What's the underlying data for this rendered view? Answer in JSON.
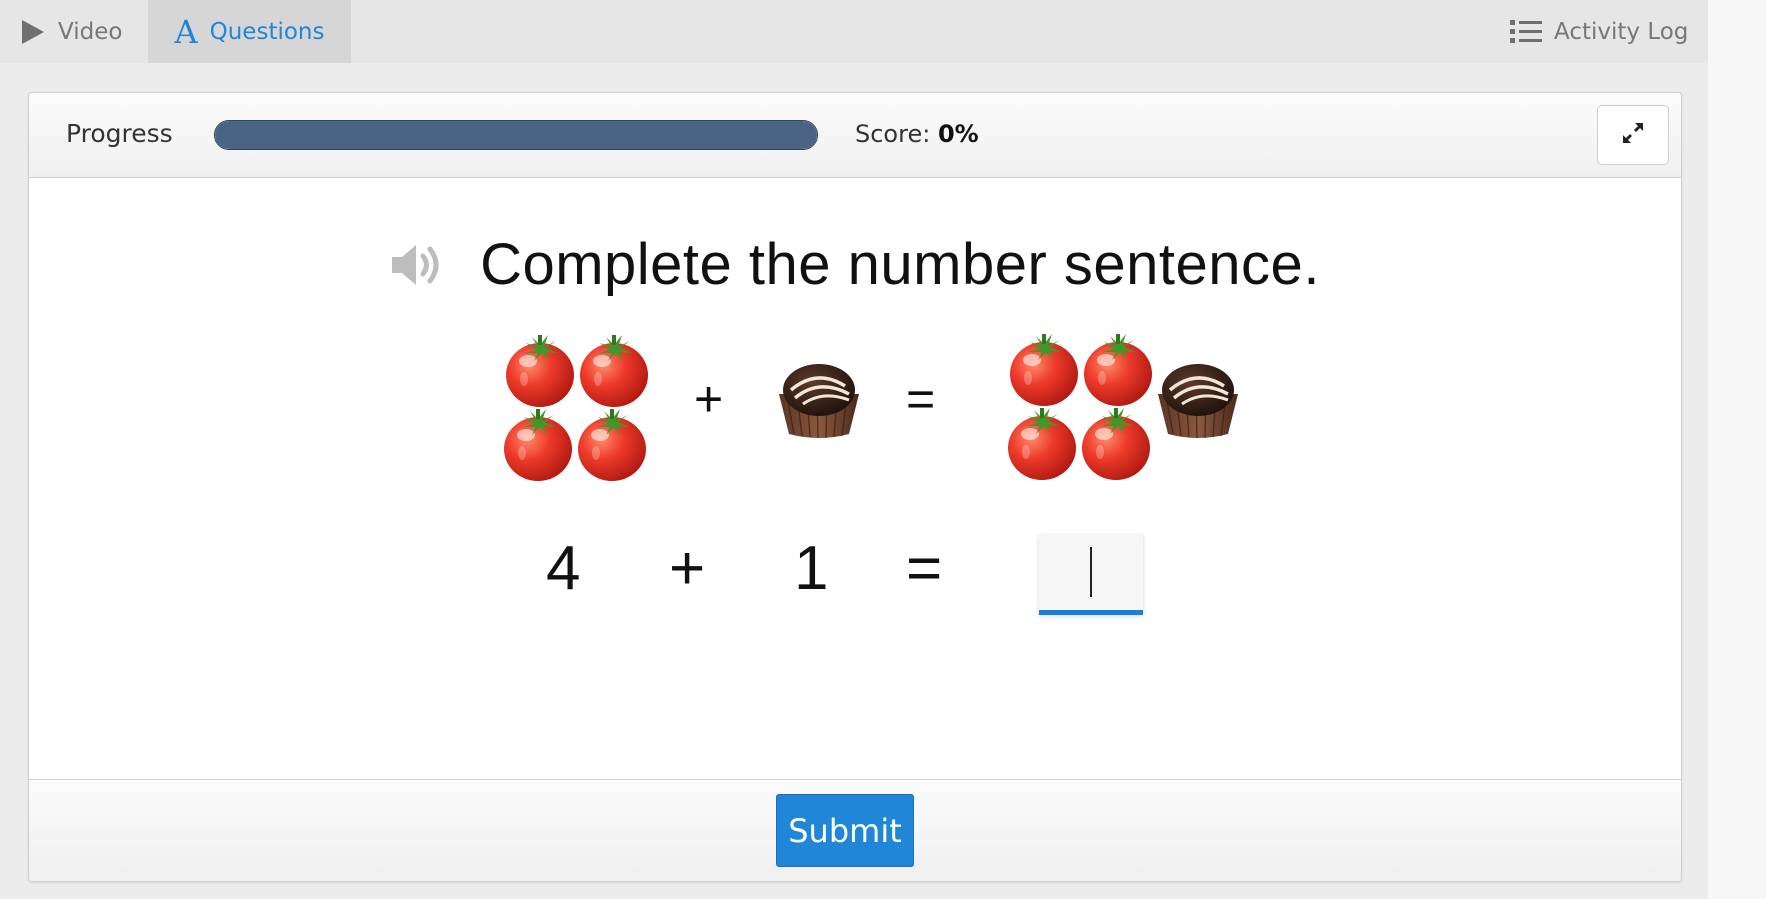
{
  "tabs": {
    "video_label": "Video",
    "questions_label": "Questions",
    "activity_log_label": "Activity Log",
    "questions_icon_glyph": "A",
    "active": "Questions"
  },
  "progress": {
    "label": "Progress",
    "fraction": 1.0,
    "score_label": "Score:",
    "score_value": "0%"
  },
  "question": {
    "title": "Complete the number sentence.",
    "picture_equation": {
      "left_items": [
        "tomato",
        "tomato",
        "tomato",
        "tomato"
      ],
      "plus": "+",
      "right_items": [
        "chocolate"
      ],
      "equals": "=",
      "result_items": [
        "tomato",
        "tomato",
        "tomato",
        "tomato",
        "chocolate"
      ]
    },
    "number_sentence": {
      "a": "4",
      "plus": "+",
      "b": "1",
      "equals": "=",
      "answer_value": ""
    }
  },
  "footer": {
    "submit_label": "Submit"
  },
  "colors": {
    "accent": "#1f86d8",
    "progress_fill": "#4a6384",
    "tomato": "#e8392c",
    "chocolate": "#3a2418"
  },
  "icons": {
    "video": "play-icon",
    "questions": "letter-a-icon",
    "activity_log": "list-icon",
    "expand": "expand-icon",
    "speaker": "speaker-icon"
  }
}
